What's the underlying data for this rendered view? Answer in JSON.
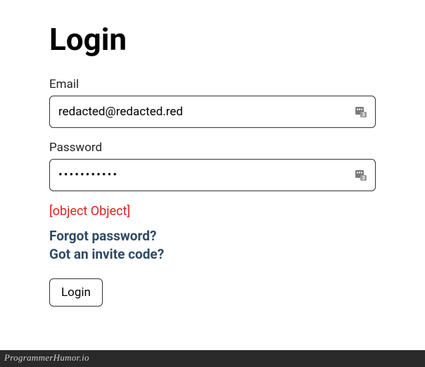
{
  "page": {
    "title": "Login"
  },
  "form": {
    "email": {
      "label": "Email",
      "value": "redacted@redacted.red"
    },
    "password": {
      "label": "Password",
      "value": "•••••••••••"
    },
    "error": "[object Object]",
    "links": {
      "forgot": "Forgot password?",
      "invite": "Got an invite code?"
    },
    "submit_label": "Login"
  },
  "watermark": "ProgrammerHumor.io"
}
